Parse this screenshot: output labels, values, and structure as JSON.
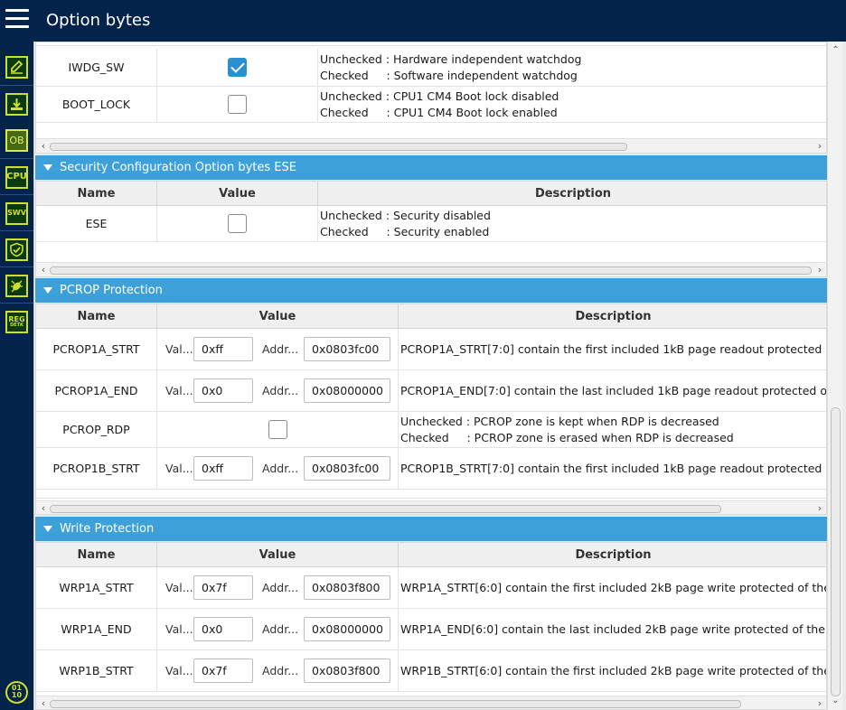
{
  "app": {
    "title": "Option bytes"
  },
  "sidebar": {
    "items": [
      {
        "name": "edit-icon"
      },
      {
        "name": "download-icon"
      },
      {
        "name": "option-bytes-icon",
        "label": "OB"
      },
      {
        "name": "cpu-icon",
        "label": "CPU"
      },
      {
        "name": "swv-icon",
        "label": "SWV"
      },
      {
        "name": "security-shield-icon"
      },
      {
        "name": "bug-icon"
      },
      {
        "name": "register-icon",
        "label": "REG",
        "sub": "DETK"
      },
      {
        "name": "binary-icon",
        "label": "01\n10"
      }
    ]
  },
  "user_config": {
    "rows": [
      {
        "name": "IWDG_SW",
        "checked": true,
        "desc": "Unchecked : Hardware independent watchdog\nChecked     : Software independent watchdog"
      },
      {
        "name": "BOOT_LOCK",
        "checked": false,
        "desc": "Unchecked : CPU1 CM4 Boot lock disabled\nChecked     : CPU1 CM4 Boot lock enabled"
      }
    ]
  },
  "ese": {
    "title": "Security Configuration Option bytes ESE",
    "headers": {
      "name": "Name",
      "value": "Value",
      "description": "Description"
    },
    "rows": [
      {
        "name": "ESE",
        "checked": false,
        "desc": "Unchecked : Security disabled\nChecked     : Security enabled"
      }
    ]
  },
  "pcrop": {
    "title": "PCROP Protection",
    "headers": {
      "name": "Name",
      "value": "Value",
      "description": "Description"
    },
    "val_label": "Val...",
    "addr_label": "Addr...",
    "rows": [
      {
        "name": "PCROP1A_STRT",
        "val": "0xff",
        "addr": "0x0803fc00",
        "desc": "PCROP1A_STRT[7:0] contain the first included 1kB page readout protected of the"
      },
      {
        "name": "PCROP1A_END",
        "val": "0x0",
        "addr": "0x08000000",
        "desc": "PCROP1A_END[7:0] contain the last included 1kB page readout protected of the"
      },
      {
        "name": "PCROP_RDP",
        "checked": false,
        "desc": "Unchecked : PCROP zone is kept when RDP is decreased\nChecked     : PCROP zone is erased when RDP is decreased"
      },
      {
        "name": "PCROP1B_STRT",
        "val": "0xff",
        "addr": "0x0803fc00",
        "desc": "PCROP1B_STRT[7:0] contain the first included 1kB page readout protected of the"
      }
    ]
  },
  "wrp": {
    "title": "Write Protection",
    "headers": {
      "name": "Name",
      "value": "Value",
      "description": "Description"
    },
    "val_label": "Val...",
    "addr_label": "Addr...",
    "rows": [
      {
        "name": "WRP1A_STRT",
        "val": "0x7f",
        "addr": "0x0803f800",
        "desc": "WRP1A_STRT[6:0] contain the first included 2kB page write protected of the Flash"
      },
      {
        "name": "WRP1A_END",
        "val": "0x0",
        "addr": "0x08000000",
        "desc": "WRP1A_END[6:0] contain the last included 2kB page write protected of the Flash"
      },
      {
        "name": "WRP1B_STRT",
        "val": "0x7f",
        "addr": "0x0803f800",
        "desc": "WRP1B_STRT[6:0] contain the first included 2kB page write protected of the Flash"
      }
    ]
  },
  "colors": {
    "topbar": "#03234b",
    "section": "#3da0d8",
    "icon_accent": "#cfe02a",
    "checkbox_checked": "#2c8fd0"
  }
}
